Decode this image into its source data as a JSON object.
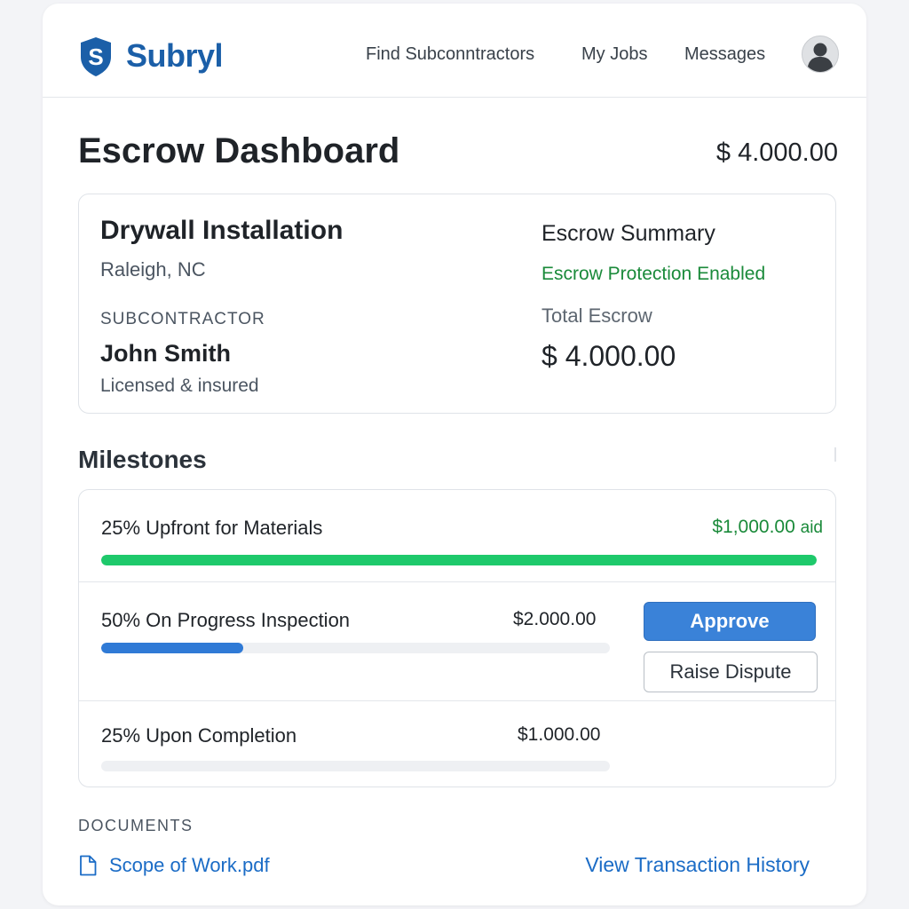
{
  "brand": {
    "name": "Subryl",
    "logo_icon": "shield-s-icon",
    "color": "#1b5fa8"
  },
  "nav": {
    "items": [
      "Find Subconntractors",
      "My Jobs",
      "Messages"
    ],
    "avatar_icon": "user-avatar-icon"
  },
  "page": {
    "title": "Escrow Dashboard",
    "total": "$ 4.000.00"
  },
  "job": {
    "title": "Drywall Installation",
    "location": "Raleigh, NC",
    "subcontractor_label": "SUBCONTRACTOR",
    "subcontractor_name": "John Smith",
    "subcontractor_note": "Licensed & insured"
  },
  "summary": {
    "title": "Escrow Summary",
    "protection": "Escrow Protection Enabled",
    "total_label": "Total Escrow",
    "total_value": "$ 4.000.00"
  },
  "milestones": {
    "title": "Milestones",
    "items": [
      {
        "label": "25% Upfront for  Materials",
        "amount": "$1,000.00",
        "status": "aid",
        "progress": 1.0,
        "color": "#1ec96b"
      },
      {
        "label": "50% On Progress Inspection",
        "amount": "$2.000.00",
        "progress": 0.28,
        "color": "#2f7ad6"
      },
      {
        "label": "25% Upon Completion",
        "amount": "$1.000.00",
        "progress": 0.0,
        "color": "#2f7ad6"
      }
    ],
    "approve_label": "Approve",
    "dispute_label": "Raise Dispute"
  },
  "documents": {
    "label": "DOCUMENTS",
    "file_name": "Scope of Work.pdf",
    "file_icon": "document-icon",
    "history_link": "View Transaction History"
  },
  "colors": {
    "accent": "#3a82d8",
    "success": "#1a8a3a",
    "link": "#1b6cc6"
  }
}
